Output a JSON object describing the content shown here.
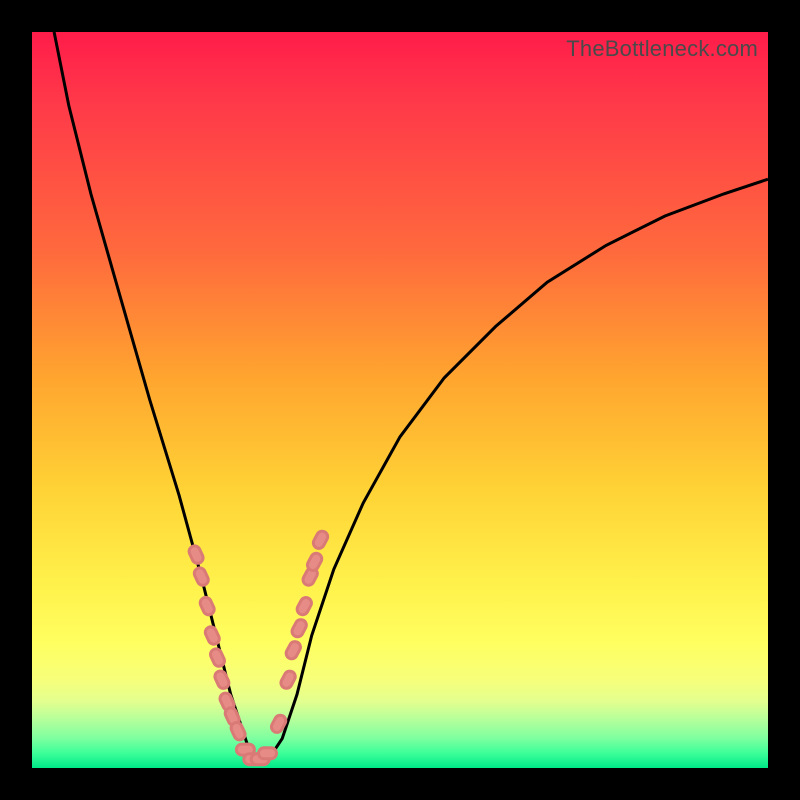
{
  "watermark": "TheBottleneck.com",
  "colors": {
    "frame": "#000000",
    "curve": "#000000",
    "marker": "#e78b87"
  },
  "chart_data": {
    "type": "line",
    "title": "",
    "xlabel": "",
    "ylabel": "",
    "xlim": [
      0,
      100
    ],
    "ylim": [
      0,
      100
    ],
    "note": "V-shaped bottleneck curve; minimum (optimal pairing) near x≈30 where bottleneck ≈ 0; both arms rise steeply toward ~100. Axis values inferred as percent bottleneck (y) vs relative component strength (x).",
    "series": [
      {
        "name": "bottleneck-curve",
        "x": [
          3,
          5,
          8,
          12,
          16,
          20,
          23,
          25,
          27,
          29,
          30,
          32,
          34,
          36,
          38,
          41,
          45,
          50,
          56,
          63,
          70,
          78,
          86,
          94,
          100
        ],
        "y": [
          100,
          90,
          78,
          64,
          50,
          37,
          26,
          18,
          10,
          4,
          1,
          1,
          4,
          10,
          18,
          27,
          36,
          45,
          53,
          60,
          66,
          71,
          75,
          78,
          80
        ]
      }
    ],
    "markers": {
      "name": "highlighted-range",
      "note": "Cluster of salmon marks surrounding the curve minimum and partway up both arms.",
      "x": [
        22.3,
        23.0,
        23.8,
        24.5,
        25.2,
        25.8,
        26.5,
        27.2,
        28.0,
        29.0,
        30.0,
        31.0,
        32.0,
        33.5,
        34.8,
        35.5,
        36.3,
        37.0,
        37.8,
        38.4,
        39.2
      ],
      "y": [
        29,
        26,
        22,
        18,
        15,
        12,
        9,
        7,
        5,
        2.5,
        1.2,
        1.2,
        2.0,
        6,
        12,
        16,
        19,
        22,
        26,
        28,
        31
      ]
    }
  }
}
